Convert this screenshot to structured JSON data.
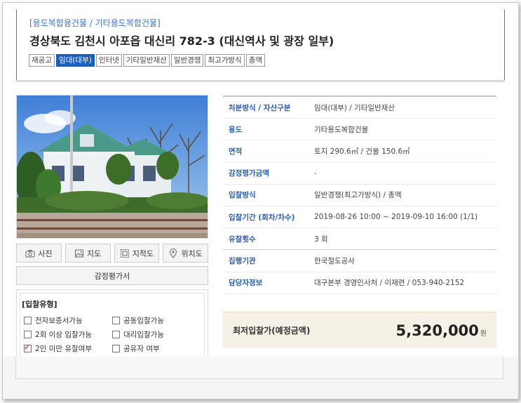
{
  "header": {
    "category": "[용도복합용건물 / 기타용도복합건물]",
    "title": "경상북도 김천시 아포읍 대신리 782-3 (대신역사 및 광장 일부)",
    "tags": [
      {
        "label": "재공고",
        "active": false
      },
      {
        "label": "임대(대부)",
        "active": true
      },
      {
        "label": "인터넷",
        "active": false
      },
      {
        "label": "기타일반재산",
        "active": false
      },
      {
        "label": "일반경쟁",
        "active": false
      },
      {
        "label": "최고가방식",
        "active": false
      },
      {
        "label": "총액",
        "active": false
      }
    ]
  },
  "buttons": {
    "photo": "사진",
    "map": "지도",
    "cadastral": "지적도",
    "location": "위치도",
    "appraisal": "감정평가서"
  },
  "bid_type": {
    "title": "[입찰유형]",
    "options": [
      {
        "label": "전자보증서가능",
        "checked": false
      },
      {
        "label": "공동입찰가능",
        "checked": false
      },
      {
        "label": "2회 이상 입찰가능",
        "checked": false
      },
      {
        "label": "대리입찰가능",
        "checked": false
      },
      {
        "label": "2인 미만 유찰여부",
        "checked": true
      },
      {
        "label": "공유자 여부",
        "checked": false
      }
    ]
  },
  "info": {
    "rows": [
      {
        "label": "처분방식 / 자산구분",
        "value": "임대(대부) / 기타일반재산"
      },
      {
        "label": "용도",
        "value": "기타용도복합건물"
      },
      {
        "label": "면적",
        "value": "토지 290.6㎡ / 건물 150.6㎡"
      },
      {
        "label": "감정평가금액",
        "value": "-"
      },
      {
        "label": "입찰방식",
        "value": "일반경쟁(최고가방식) / 총액"
      },
      {
        "label": "입찰기간 (회차/차수)",
        "value": "2019-08-26 10:00 ~ 2019-09-10 16:00 (1/1)"
      },
      {
        "label": "유찰횟수",
        "value": "3 회"
      }
    ],
    "rows2": [
      {
        "label": "집행기관",
        "value": "한국철도공사"
      },
      {
        "label": "담당자정보",
        "value": "대구본부 경영인사처 / 이재련 / 053-940-2152"
      }
    ]
  },
  "price": {
    "label": "최저입찰가(예정금액)",
    "value": "5,320,000",
    "unit": "원"
  },
  "colors": {
    "accent": "#3b74c9",
    "active_tag": "#1c5fb8",
    "label_blue": "#2a5db0",
    "price_bg": "#f6f1e6"
  }
}
